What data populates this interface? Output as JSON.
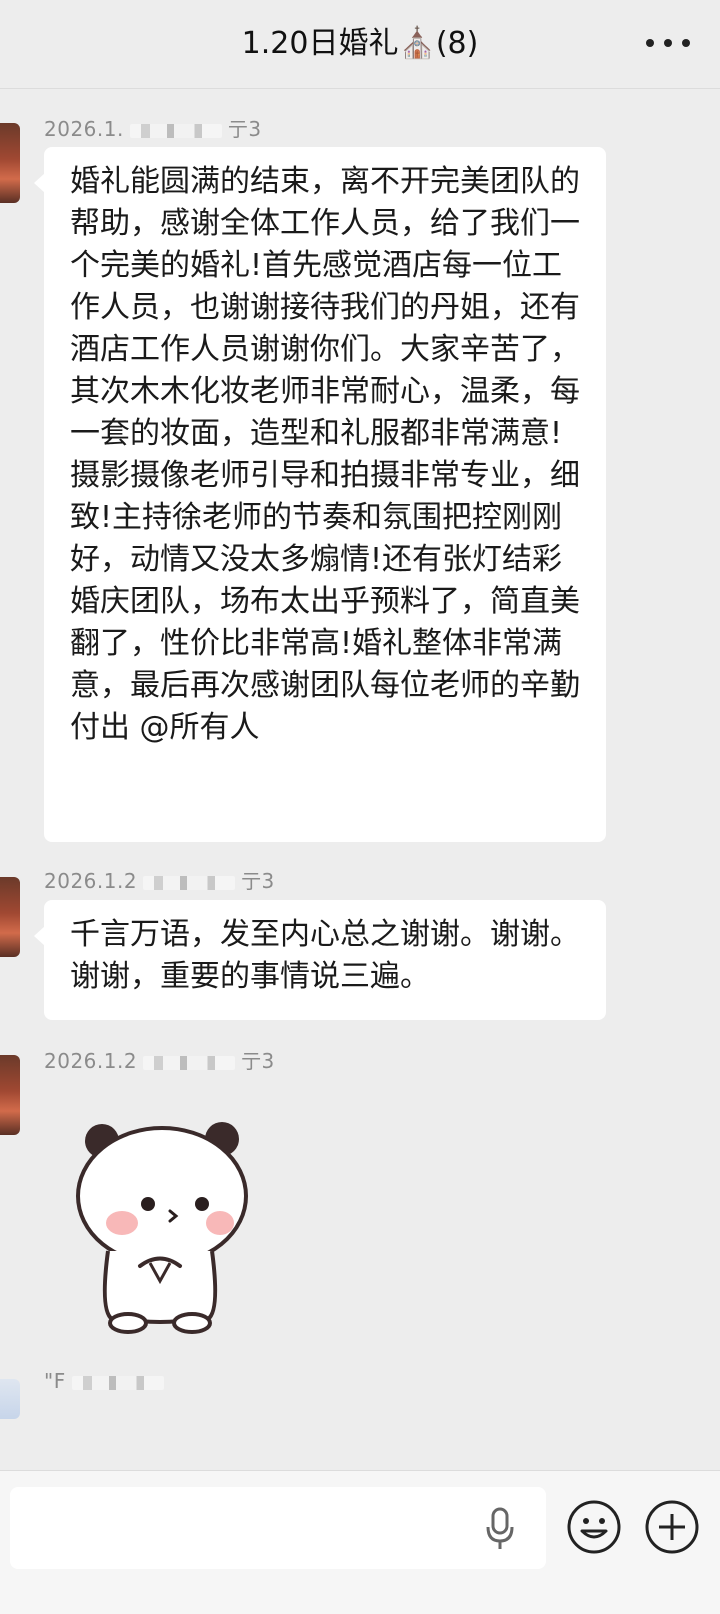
{
  "header": {
    "title": "1.20日婚礼⛪(8)",
    "more_icon": "more-icon"
  },
  "messages": [
    {
      "meta_prefix": "2026.1.",
      "meta_suffix": "亍3",
      "text": "婚礼能圆满的结束，离不开完美团队的帮助，感谢全体工作人员，给了我们一个完美的婚礼!首先感觉酒店每一位工作人员，也谢谢接待我们的丹姐，还有酒店工作人员谢谢你们。大家辛苦了，其次木木化妆老师非常耐心，温柔，每一套的妆面，造型和礼服都非常满意!摄影摄像老师引导和拍摄非常专业，细致!主持徐老师的节奏和氛围把控刚刚好，动情又没太多煽情!还有张灯结彩婚庆团队，场布太出乎预料了，简直美翻了，性价比非常高!婚礼整体非常满意，最后再次感谢团队每位老师的辛勤付出 @所有人"
    },
    {
      "meta_prefix": "2026.1.2",
      "meta_suffix": "亍3",
      "text": "千言万语，发至内心总之谢谢。谢谢。谢谢，重要的事情说三遍。"
    },
    {
      "meta_prefix": "2026.1.2",
      "meta_suffix": "亍3",
      "sticker": "panda-sticker"
    },
    {
      "meta_prefix": "\"F",
      "meta_suffix": ""
    }
  ],
  "input_bar": {
    "placeholder": "",
    "icons": [
      "mic-icon",
      "emoji-icon",
      "plus-icon"
    ]
  },
  "colors": {
    "background": "#ededed",
    "bubble": "#ffffff",
    "meta_text": "#8b8b8b"
  }
}
